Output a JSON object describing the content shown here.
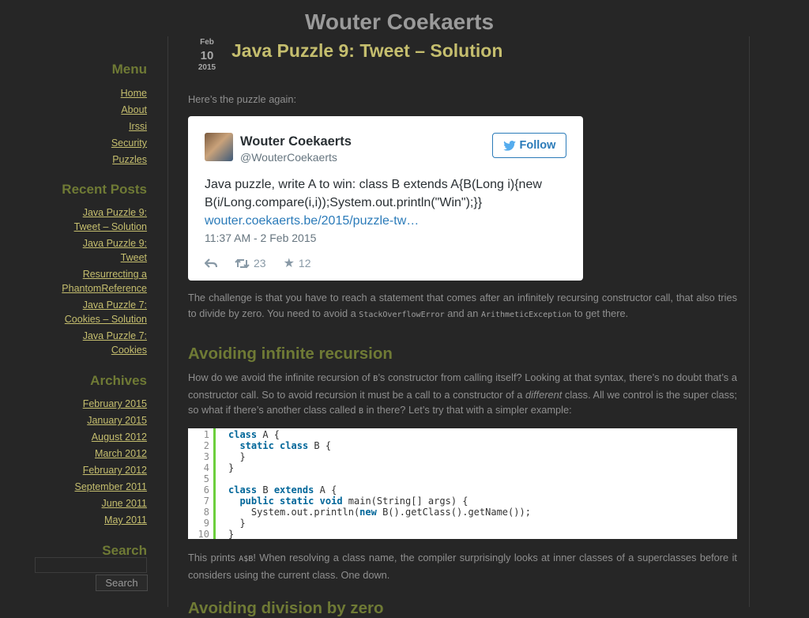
{
  "site": {
    "title": "Wouter Coekaerts"
  },
  "sidebar": {
    "menu_heading": "Menu",
    "menu": [
      "Home",
      "About",
      "Irssi",
      "Security",
      "Puzzles"
    ],
    "recent_heading": "Recent Posts",
    "recent": [
      "Java Puzzle 9: Tweet – Solution",
      "Java Puzzle 9: Tweet",
      "Resurrecting a PhantomReference",
      "Java Puzzle 7: Cookies – Solution",
      "Java Puzzle 7: Cookies"
    ],
    "archives_heading": "Archives",
    "archives": [
      "February 2015",
      "January 2015",
      "August 2012",
      "March 2012",
      "February 2012",
      "September 2011",
      "June 2011",
      "May 2011"
    ],
    "search_heading": "Search",
    "search_value": "",
    "search_button": "Search"
  },
  "post": {
    "date": {
      "month": "Feb",
      "day": "10",
      "year": "2015"
    },
    "title": "Java Puzzle 9: Tweet – Solution",
    "intro": "Here’s the puzzle again:",
    "para1_a": "The challenge is that you have to reach a statement that comes after an infinitely recursing constructor call, that also tries to divide by zero. You need to avoid a ",
    "para1_code1": "StackOverflowError",
    "para1_b": " and an ",
    "para1_code2": "ArithmeticException",
    "para1_c": " to get there.",
    "section_heading": "Avoiding infinite recursion",
    "para2_a": "How do we avoid the infinite recursion of ",
    "para2_code1": "B",
    "para2_b": "’s constructor from calling itself? Looking at that syntax, there’s no doubt that’s a constructor call. So to avoid recursion it must be a call to a constructor of a ",
    "para2_em": "different",
    "para2_c": " class. All we control is the super class; so what if there’s another class called ",
    "para2_code2": "B",
    "para2_d": " in there? Let’s try that with a simpler example:",
    "para3_a": "This prints ",
    "para3_code": "A$B",
    "para3_b": "! When resolving a class name, the compiler surprisingly looks at inner classes of a superclasses before it considers using the current class. One down.",
    "cut_heading": "Avoiding division by zero"
  },
  "tweet": {
    "name": "Wouter Coekaerts",
    "handle": "@WouterCoekaerts",
    "follow": "Follow",
    "text": "Java puzzle, write A to win: class B extends A{B(Long i){new B(i/Long.compare(i,i));System.out.println(\"Win\");}}",
    "link": "wouter.coekaerts.be/2015/puzzle-tw…",
    "time": "11:37 AM - 2 Feb 2015",
    "retweets": "23",
    "favorites": "12"
  },
  "code": {
    "line_numbers": [
      "1",
      "2",
      "3",
      "4",
      "5",
      "6",
      "7",
      "8",
      "9",
      "10"
    ]
  },
  "colors": {
    "accent_link": "#c5be6e",
    "heading_green": "#6f7a35",
    "twitter_blue": "#2b7bb9",
    "code_gutter": "#6ccf3c"
  }
}
